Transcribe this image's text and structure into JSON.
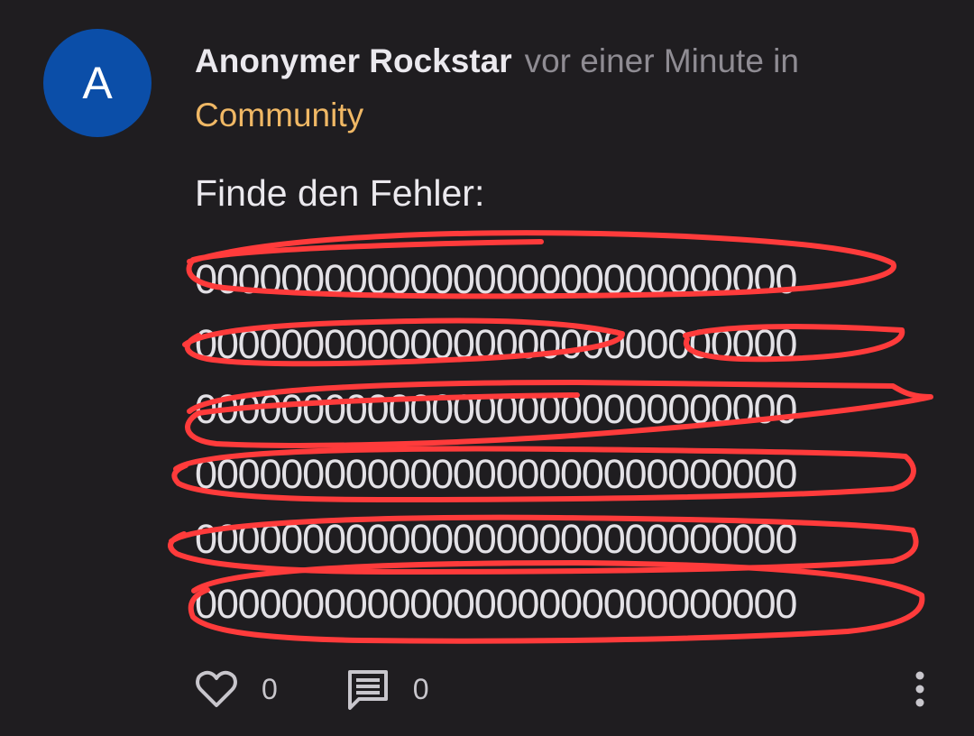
{
  "post": {
    "avatar_letter": "A",
    "author": "Anonymer Rockstar",
    "time_text": "vor einer Minute in",
    "category": "Community",
    "text": "Finde den Fehler:",
    "zero_lines": [
      "0000000000000000000000000000",
      "0000000000000000000000000000",
      "0000000000000000000000000000",
      "0000000000000000000000000000",
      "0000000000000000000000000000",
      "0000000000000000000000000000"
    ]
  },
  "actions": {
    "like_icon": "heart-outline-icon",
    "like_count": "0",
    "comment_icon": "comment-icon",
    "comment_count": "0",
    "more_icon": "more-vertical-icon"
  },
  "colors": {
    "background": "#1f1d20",
    "avatar": "#0b4ea8",
    "category": "#f0b865",
    "annotation": "#ff3b3b"
  }
}
